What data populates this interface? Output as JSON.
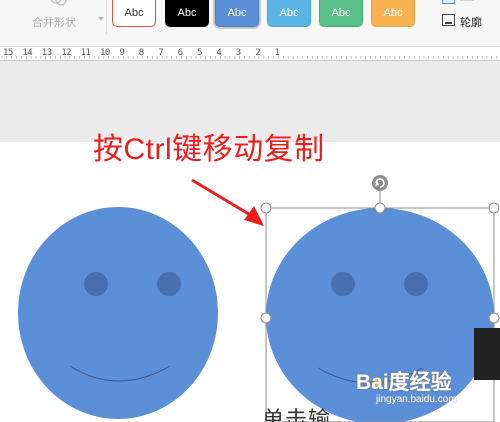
{
  "ribbon": {
    "merge_shapes_label": "合并形状",
    "style_swatches": [
      {
        "label": "Abc",
        "bg": "#ffffff",
        "color": "#333333",
        "border": "#d9534f"
      },
      {
        "label": "Abc",
        "bg": "#000000",
        "color": "#ffffff",
        "border": "#000000"
      },
      {
        "label": "Abc",
        "bg": "#5b8fd8",
        "color": "#ffffff",
        "border": "#4a7cc2",
        "selected": true
      },
      {
        "label": "Abc",
        "bg": "#5cb3e6",
        "color": "#ffffff",
        "border": "#4aa3d6"
      },
      {
        "label": "Abc",
        "bg": "#59c089",
        "color": "#ffffff",
        "border": "#48ad78"
      },
      {
        "label": "Abc",
        "bg": "#f7b34f",
        "color": "#ffffff",
        "border": "#e6a23e"
      }
    ],
    "outline_label": "轮廓"
  },
  "ruler": {
    "numbers": [
      "15",
      "14",
      "13",
      "12",
      "11",
      "10",
      "9",
      "8",
      "7",
      "6",
      "5",
      "4",
      "3",
      "2",
      "1"
    ]
  },
  "annotation": {
    "text": "按Ctrl键移动复制",
    "color": "#ee1c1c"
  },
  "shapes": {
    "fill_color": "#5b8fd8",
    "eye_color": "#4a6fae",
    "smile_color": "#3e5d94"
  },
  "page_text_fragment": "单击输",
  "watermark": {
    "main": "Bai度经验",
    "sub": "jingyan.baidu.com"
  }
}
